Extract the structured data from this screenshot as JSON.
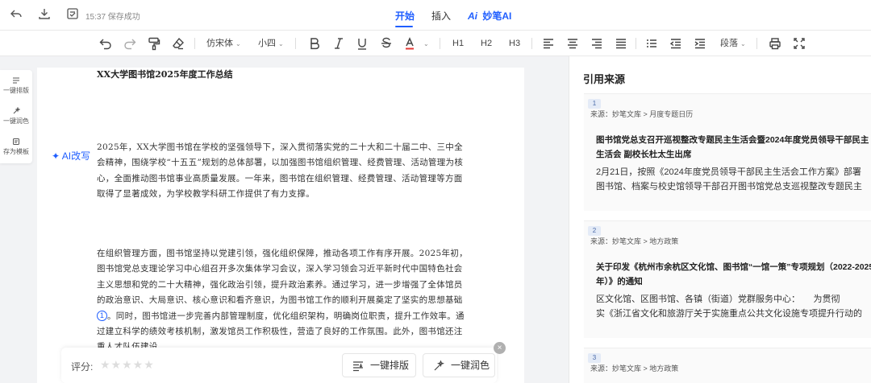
{
  "header": {
    "save_status": "15:37 保存成功",
    "tabs": [
      {
        "label": "开始",
        "active": true
      },
      {
        "label": "插入",
        "active": false
      }
    ],
    "ai_badge": "Ai",
    "ai_label": "妙笔AI"
  },
  "toolbar": {
    "font_family": "仿宋体",
    "font_size": "小四",
    "h1": "H1",
    "h2": "H2",
    "h3": "H3",
    "paragraph": "段落"
  },
  "sidebar": {
    "items": [
      {
        "label": "一键排版",
        "icon": "format-icon"
      },
      {
        "label": "一键润色",
        "icon": "polish-icon"
      },
      {
        "label": "存为模板",
        "icon": "template-icon"
      }
    ]
  },
  "document": {
    "title": "XX大学图书馆2025年度工作总结",
    "ai_rewrite": "AI改写",
    "para1": "2025年，XX大学图书馆在学校的坚强领导下，深入贯彻落实党的二十大和二十届二中、三中全会精神，围绕学校“十五五”规划的总体部署，以加强图书馆组织管理、经费管理、活动管理为核心，全面推动图书馆事业高质量发展。一年来，图书馆在组织管理、经费管理、活动管理等方面取得了显著成效，为学校教学科研工作提供了有力支撑。",
    "para2a": "在组织管理方面，图书馆坚持以党建引领，强化组织保障，推动各项工作有序开展。2025年初，图书馆党总支理论学习中心组召开多次集体学习会议，深入学习领会习近平新时代中国特色社会主义思想和党的二十大精神，强化政治引领，提升政治素养。通过学习，进一步增强了全体馆员的政治意识、大局意识、核心意识和看齐意识，为图书馆工作的顺利开展奠定了坚实的思想基础",
    "citation": "1",
    "para2b": "。同时，图书馆进一步完善内部管理制度，优化组织架构，明确岗位职责，提升工作效率。通过建立科学的绩效考核机制，激发馆员工作积极性，营造了良好的工作氛围。此外，图书馆还注重人才队伍建设"
  },
  "bottom_bar": {
    "rating_label": "评分:",
    "stars": "★★★★★",
    "format_button": "一键排版",
    "polish_button": "一键润色",
    "close": "×"
  },
  "references": {
    "title": "引用来源",
    "cards": [
      {
        "num": "1",
        "source": "来源：妙笔文库 > 月度专题日历",
        "title": "图书馆党总支召开巡视整改专题民主生活会暨2024年度党员领导干部民主生活会 副校长杜太生出席",
        "body1": "2月21日，按照《2024年度党员领导干部民主生活会工作方案》部署",
        "body2": "图书馆、档案与校史馆领导干部召开图书馆党总支巡视整改专题民主"
      },
      {
        "num": "2",
        "source": "来源：妙笔文库 > 地方政策",
        "title": "关于印发《杭州市余杭区文化馆、图书馆“一馆一策”专项规划（2022-2025年）》的通知",
        "body1": "区文化馆、区图书馆、各镇（街道）党群服务中心：　　为贯彻",
        "body2": "实《浙江省文化和旅游厅关于实施重点公共文化设施专项提升行动的"
      },
      {
        "num": "3",
        "source": "来源：妙笔文库 > 地方政策"
      }
    ]
  },
  "colors": {
    "accent": "#1f5eff",
    "page_bg": "#f2f3f5"
  }
}
